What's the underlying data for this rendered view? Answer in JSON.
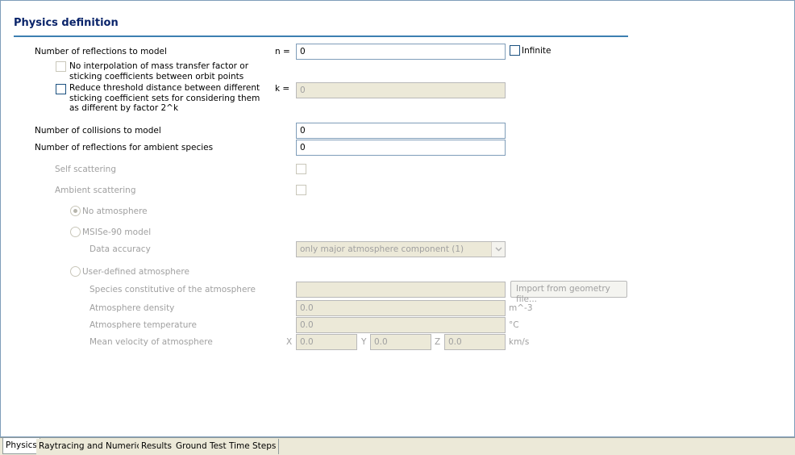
{
  "section": {
    "title": "Physics definition"
  },
  "reflections": {
    "label": "Number of reflections to model",
    "n_label": "n =",
    "n_value": "0",
    "infinite_label": "Infinite",
    "no_interp_label": "No interpolation of mass transfer factor or sticking coefficients between orbit points",
    "reduce_label": "Reduce threshold distance between different sticking coefficient sets for considering them as different by factor 2^k",
    "k_label": "k =",
    "k_value": "0"
  },
  "collisions": {
    "label": "Number of collisions to model",
    "value": "0"
  },
  "ambient_reflections": {
    "label": "Number of reflections for ambient species",
    "value": "0"
  },
  "self_scattering": {
    "label": "Self scattering"
  },
  "ambient_scattering": {
    "label": "Ambient scattering"
  },
  "atmosphere": {
    "no_atmosphere_label": "No atmosphere",
    "msise_label": "MSISe-90 model",
    "data_accuracy_label": "Data accuracy",
    "data_accuracy_value": "only major atmosphere component (1)",
    "user_defined_label": "User-defined atmosphere",
    "species_label": "Species constitutive of the atmosphere",
    "species_value": "",
    "import_button": "Import from geometry file...",
    "density_label": "Atmosphere density",
    "density_value": "0.0",
    "density_unit": "m^-3",
    "temperature_label": "Atmosphere temperature",
    "temperature_value": "0.0",
    "temperature_unit": "°C",
    "velocity_label": "Mean velocity of atmosphere",
    "x_label": "X",
    "x_value": "0.0",
    "y_label": "Y",
    "y_value": "0.0",
    "z_label": "Z",
    "z_value": "0.0",
    "velocity_unit": "km/s"
  },
  "tabs": [
    {
      "label": "Physics"
    },
    {
      "label": "Raytracing and Numerics"
    },
    {
      "label": "Results"
    },
    {
      "label": "Ground Test Time Steps"
    }
  ]
}
